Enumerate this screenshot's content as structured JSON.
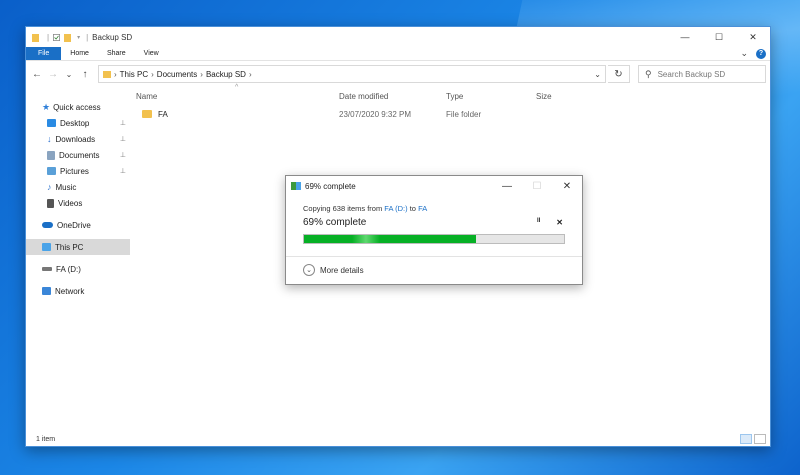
{
  "window": {
    "title": "Backup SD",
    "minimize": "—",
    "maximize": "☐",
    "close": "✕"
  },
  "ribbon": {
    "tabs": [
      {
        "label": "File"
      },
      {
        "label": "Home"
      },
      {
        "label": "Share"
      },
      {
        "label": "View"
      }
    ],
    "expand": "⌄",
    "help": "?"
  },
  "navbar": {
    "back": "←",
    "forward": "→",
    "recent": "⌄",
    "up": "↑",
    "breadcrumbs": [
      "This PC",
      "Documents",
      "Backup SD"
    ],
    "separator": "›",
    "dropdown": "⌄",
    "refresh": "↻",
    "search_placeholder": "Search Backup SD"
  },
  "sidebar": {
    "items": [
      {
        "label": "Quick access",
        "icon": "star-icon",
        "color": "#2f7fd8"
      },
      {
        "label": "Desktop",
        "icon": "desktop-icon",
        "color": "#2a8be3",
        "pinned": true
      },
      {
        "label": "Downloads",
        "icon": "download-icon",
        "color": "#2a6fd0",
        "pinned": true
      },
      {
        "label": "Documents",
        "icon": "documents-icon",
        "color": "#8aa4c0",
        "pinned": true
      },
      {
        "label": "Pictures",
        "icon": "pictures-icon",
        "color": "#5aa0d8",
        "pinned": true
      },
      {
        "label": "Music",
        "icon": "music-icon",
        "color": "#3a7bd0"
      },
      {
        "label": "Videos",
        "icon": "videos-icon",
        "color": "#555"
      },
      {
        "label": "OneDrive",
        "icon": "cloud-icon",
        "color": "#1a6fc6"
      },
      {
        "label": "This PC",
        "icon": "computer-icon",
        "color": "#4aa3e8"
      },
      {
        "label": "FA (D:)",
        "icon": "drive-icon",
        "color": "#777"
      },
      {
        "label": "Network",
        "icon": "network-icon",
        "color": "#3a86d8"
      }
    ],
    "pin_glyph": "📌"
  },
  "files": {
    "columns": [
      "Name",
      "Date modified",
      "Type",
      "Size"
    ],
    "sort_caret": "^",
    "rows": [
      {
        "name": "FA",
        "date": "23/07/2020 9:32 PM",
        "type": "File folder",
        "size": ""
      }
    ]
  },
  "status": {
    "count": "1 item"
  },
  "dialog": {
    "title": "69% complete",
    "copying_prefix": "Copying 638 items from ",
    "source": "FA (D:)",
    "to_word": " to ",
    "dest": "FA",
    "percent_text": "69% complete",
    "progress": 0.66,
    "pause": "II",
    "cancel": "✕",
    "minimize": "—",
    "maximize": "☐",
    "close": "✕",
    "more_details": "More details",
    "more_glyph": "⌄"
  }
}
